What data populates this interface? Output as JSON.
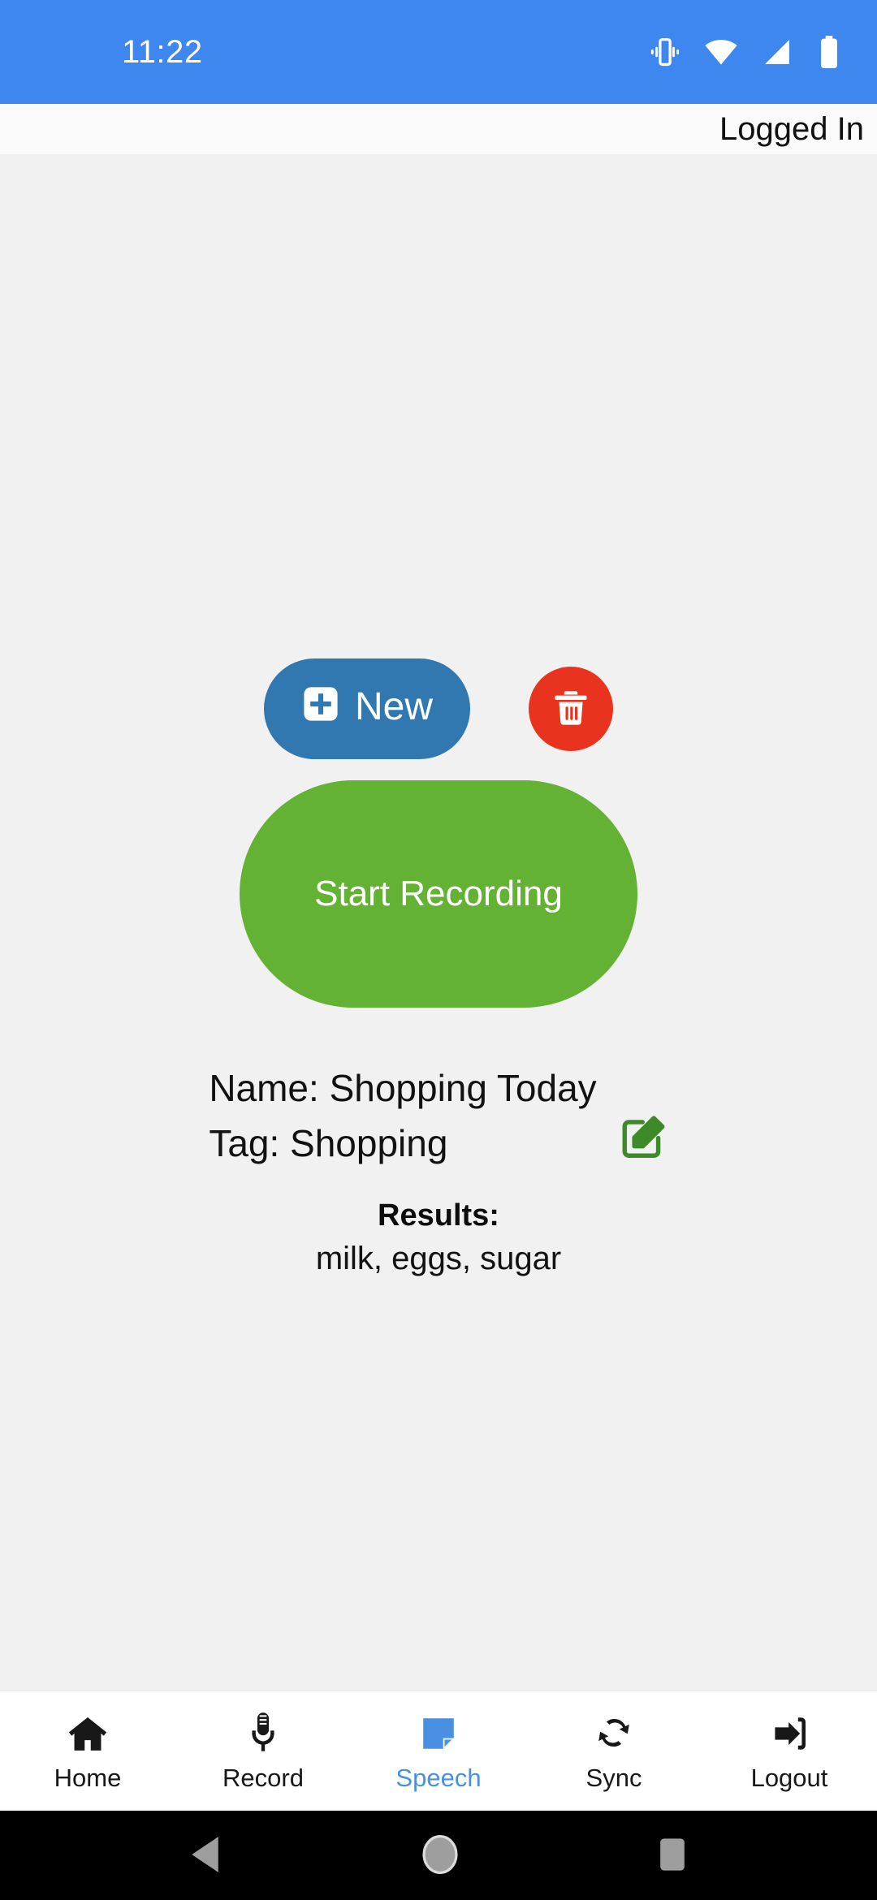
{
  "status_bar": {
    "time": "11:22",
    "icons": [
      "vibrate-icon",
      "wifi-icon",
      "cellular-signal-icon",
      "battery-icon"
    ],
    "background_color": "#3d87ee"
  },
  "app_header": {
    "login_status": "Logged In"
  },
  "main": {
    "new_button": {
      "label": "New",
      "icon": "plus-square-icon",
      "color": "#3178b0"
    },
    "delete_button": {
      "icon": "trash-icon",
      "color": "#e8341f"
    },
    "record_button": {
      "label": "Start Recording",
      "color": "#63b234"
    },
    "edit_button": {
      "icon": "pen-to-square-icon",
      "color": "#3d8b28"
    },
    "name_line": "Name: Shopping Today",
    "tag_line": "Tag: Shopping",
    "results_title": "Results:",
    "results_text": "milk, eggs, sugar"
  },
  "tabbar": {
    "active_color": "#4a90e2",
    "items": [
      {
        "label": "Home",
        "icon": "home-icon",
        "active": false
      },
      {
        "label": "Record",
        "icon": "microphone-icon",
        "active": false
      },
      {
        "label": "Speech",
        "icon": "note-icon",
        "active": true
      },
      {
        "label": "Sync",
        "icon": "refresh-icon",
        "active": false
      },
      {
        "label": "Logout",
        "icon": "sign-out-icon",
        "active": false
      }
    ]
  },
  "android_nav": {
    "items": [
      "back-triangle-icon",
      "home-circle-icon",
      "recents-square-icon"
    ]
  }
}
